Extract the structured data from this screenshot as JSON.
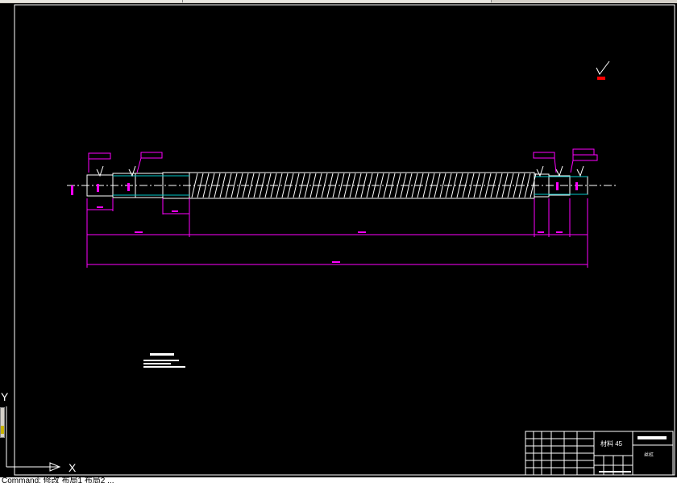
{
  "statusbar": {
    "text": "Command: 修改 布局1 布局2 ..."
  },
  "ucs": {
    "y_label": "Y",
    "x_label": "X"
  },
  "material": {
    "text": "材料 45"
  },
  "title_block": {
    "part_name": "丝杠"
  },
  "colors": {
    "background": "#000000",
    "frame": "#ffffff",
    "part_outline": "#ffffff",
    "dimension": "#ff00ff",
    "centerline": "#ffffff",
    "hidden": "#00c8c8",
    "highlight": "#ff0000"
  },
  "icons": [
    "ucs-icon",
    "roughness-symbol-icon"
  ]
}
